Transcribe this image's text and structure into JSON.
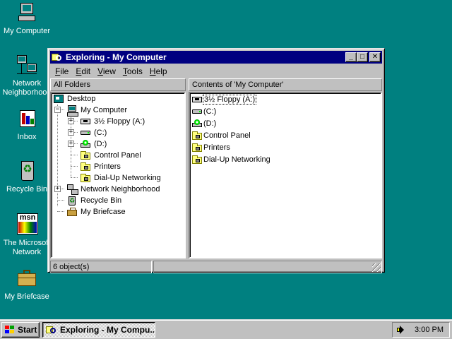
{
  "desktop": {
    "icons": [
      {
        "label": "My Computer",
        "icon": "my-computer-icon"
      },
      {
        "label": "Network Neighborhood",
        "icon": "network-neighborhood-icon"
      },
      {
        "label": "Inbox",
        "icon": "inbox-icon"
      },
      {
        "label": "Recycle Bin",
        "icon": "recycle-bin-icon"
      },
      {
        "label": "The Microsoft Network",
        "icon": "msn-icon"
      },
      {
        "label": "My Briefcase",
        "icon": "briefcase-icon"
      }
    ],
    "network_line1": "Network",
    "network_line2": "Neighborhood",
    "msn_line1": "The Microsoft",
    "msn_line2": "Network",
    "msn_logo": "msn"
  },
  "window": {
    "title": "Exploring - My Computer",
    "minimize_glyph": "_",
    "maximize_glyph": "□",
    "close_glyph": "✕",
    "menu": [
      {
        "key": "F",
        "rest": "ile"
      },
      {
        "key": "E",
        "rest": "dit"
      },
      {
        "key": "V",
        "rest": "iew"
      },
      {
        "key": "T",
        "rest": "ools"
      },
      {
        "key": "H",
        "rest": "elp"
      }
    ],
    "left_header": "All Folders",
    "right_header": "Contents of 'My Computer'",
    "tree": {
      "desktop": "Desktop",
      "my_computer": "My Computer",
      "floppy": "3½ Floppy (A:)",
      "c_drive": "(C:)",
      "d_drive": "(D:)",
      "control_panel": "Control Panel",
      "printers": "Printers",
      "dialup": "Dial-Up Networking",
      "network": "Network Neighborhood",
      "recycle": "Recycle Bin",
      "briefcase": "My Briefcase",
      "expand_glyph": "+",
      "collapse_glyph": "−"
    },
    "contents": [
      "3½ Floppy (A:)",
      "(C:)",
      "(D:)",
      "Control Panel",
      "Printers",
      "Dial-Up Networking"
    ],
    "status": "6 object(s)"
  },
  "taskbar": {
    "start_label": "Start",
    "task_label": "Exploring - My Compu...",
    "clock": "3:00 PM"
  },
  "colors": {
    "desktop": "#008080",
    "titlebar": "#000080",
    "face": "#c0c0c0"
  }
}
